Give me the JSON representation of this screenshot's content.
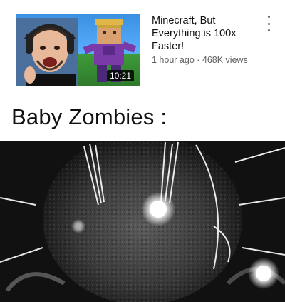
{
  "video": {
    "title": "Minecraft, But\nEverything is 100x\nFaster!",
    "stats": "1 hour ago · 468K views",
    "duration": "10:21",
    "more_icon": "vertical-ellipsis-icon"
  },
  "caption": "Baby Zombies :"
}
